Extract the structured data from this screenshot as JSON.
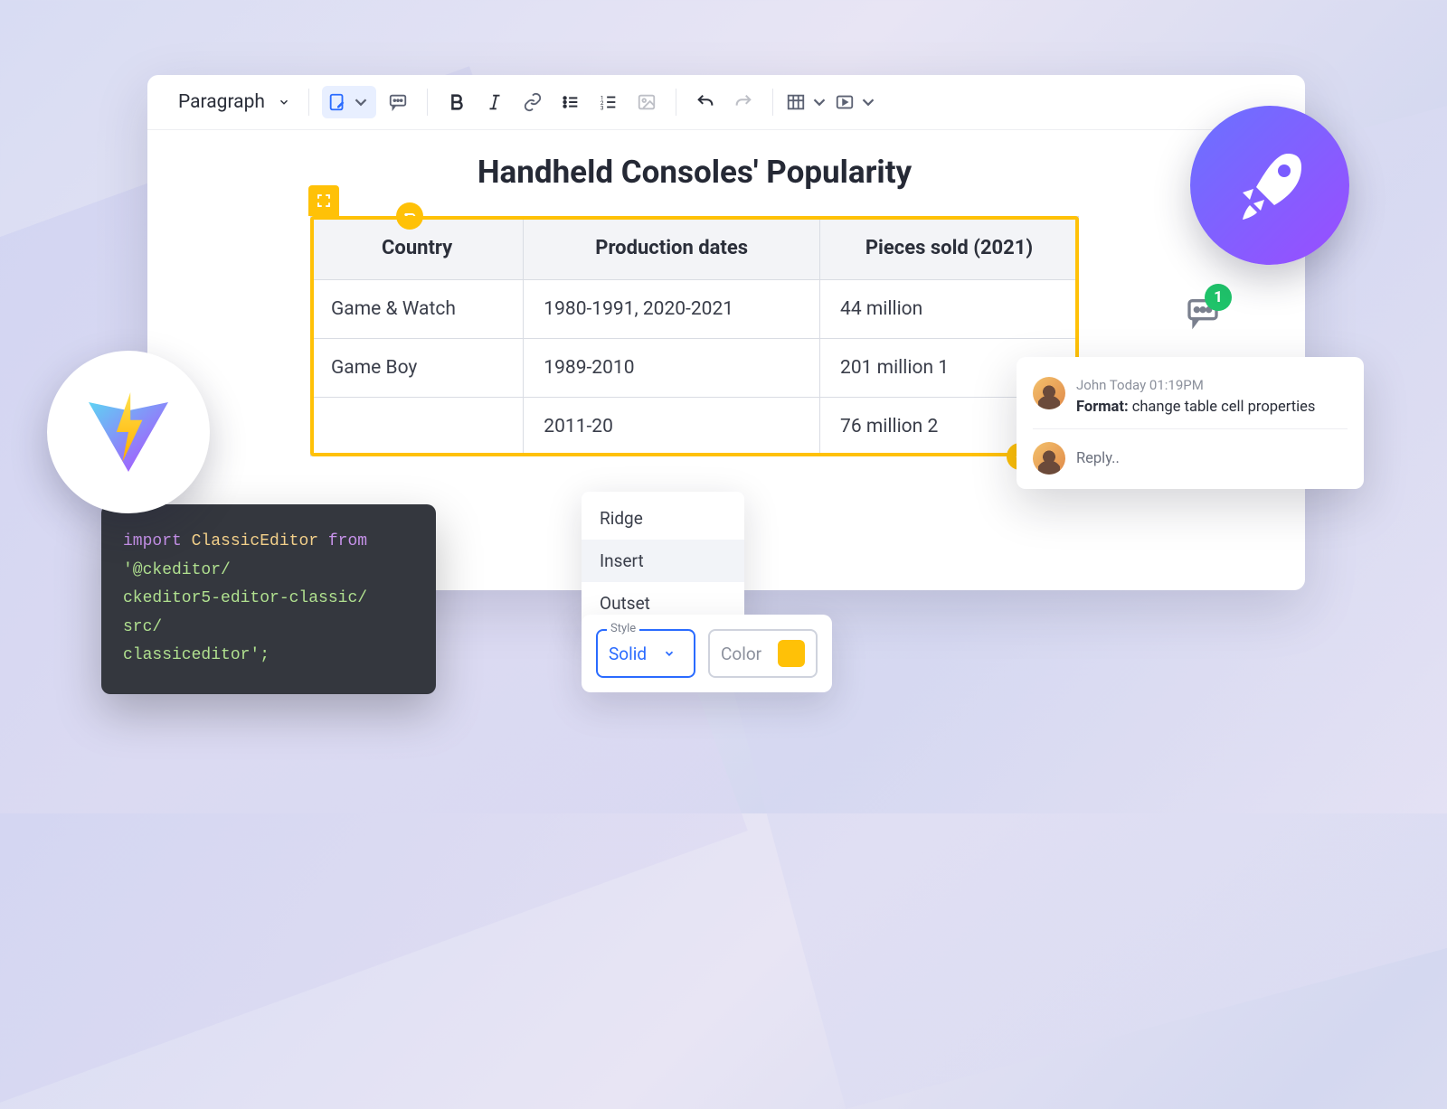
{
  "toolbar": {
    "style_label": "Paragraph"
  },
  "doc": {
    "title": "Handheld Consoles' Popularity",
    "table": {
      "headers": [
        "Country",
        "Production dates",
        "Pieces sold (2021)"
      ],
      "rows": [
        [
          "Game & Watch",
          "1980-1991, 2020-2021",
          "44 million"
        ],
        [
          "Game Boy",
          "1989-2010",
          "201 million 1"
        ],
        [
          "",
          "2011-20",
          "76 million 2"
        ]
      ]
    }
  },
  "comment": {
    "badge": "1",
    "author_line": "John Today 01:19PM",
    "body_label": "Format:",
    "body_text": " change table cell properties",
    "reply_placeholder": "Reply.."
  },
  "dropdown": {
    "items": [
      "Ridge",
      "Insert",
      "Outset"
    ]
  },
  "props": {
    "style_label": "Style",
    "style_value": "Solid",
    "color_label": "Color",
    "swatch": "#ffc107"
  },
  "code": {
    "kw_import": "import",
    "class_name": "ClassicEditor",
    "kw_from": "from",
    "path": "'@ckeditor/\nckeditor5-editor-classic/\nsrc/\nclassiceditor';"
  }
}
